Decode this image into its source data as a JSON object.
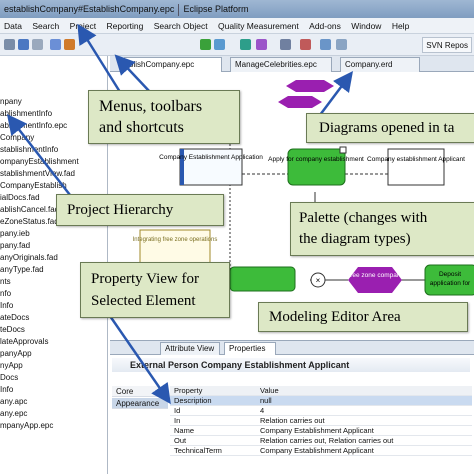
{
  "window": {
    "title_fragment": "establishCompany#EstablishCompany.epc",
    "title_app": "Eclipse Platform"
  },
  "menu": [
    "Data",
    "Search",
    "Project",
    "Reporting",
    "Search Object",
    "Quality Measurement",
    "Add-ons",
    "Window",
    "Help"
  ],
  "toolbar": {
    "svn_label": "SVN Repos"
  },
  "editor_tabs": [
    {
      "label": "blishCompany.epc",
      "active": true
    },
    {
      "label": "ManageCelebrities.epc",
      "active": false
    },
    {
      "label": "Company.erd",
      "active": false
    }
  ],
  "tree": [
    "npany",
    "ablishmentInfo",
    "ablishmentInfo.epc",
    "Company",
    "stablishmentInfo",
    "ompanyEstablishment",
    "stablishmentView.fad",
    "CompanyEstablish",
    "ialDocs.fad",
    "ablishCancel.fad",
    "eZoneStatus.fad",
    "pany.ieb",
    "pany.fad",
    "anyOriginals.fad",
    "anyType.fad",
    "nts",
    "nfo",
    "Info",
    "ateDocs",
    "teDocs",
    "lateApprovals",
    "panyApp",
    "nyApp",
    "Docs",
    "Info",
    "any.apc",
    "any.epc",
    "mpanyApp.epc"
  ],
  "diagram": {
    "node1": "Company Establishment Application",
    "node2": "Apply for company establishment",
    "node3": "Company establishment Applicant",
    "node4": "Integrating free zone operations",
    "node5": "Free zone company",
    "node6a": "Deposit",
    "node6b": "application for"
  },
  "properties": {
    "tabs": [
      "Attribute View",
      "Properties"
    ],
    "title": "External Person Company Establishment Applicant",
    "sidebar": [
      "Core",
      "Appearance"
    ],
    "columns": [
      "Property",
      "Value"
    ],
    "rows": [
      {
        "property": "Description",
        "value": "null"
      },
      {
        "property": "Id",
        "value": "4"
      },
      {
        "property": "In",
        "value": "Relation carries out"
      },
      {
        "property": "Name",
        "value": "Company Establishment Applicant"
      },
      {
        "property": "Out",
        "value": "Relation carries out, Relation carries out"
      },
      {
        "property": "TechnicalTerm",
        "value": "Company Establishment Applicant"
      }
    ]
  },
  "callouts": {
    "menus_line1": "Menus, toolbars",
    "menus_line2": "and shortcuts",
    "diagrams": "Diagrams opened in ta",
    "hierarchy": "Project Hierarchy",
    "palette_line1": "Palette (changes with",
    "palette_line2": "the diagram types)",
    "propview_line1": "Property View for",
    "propview_line2": "Selected Element",
    "modeling": "Modeling Editor Area"
  },
  "colors": {
    "callout_fill": "#dde8c6",
    "event_purple": "#9a1fb0",
    "function_green": "#3dbb3a",
    "cube_yellow": "#ffe066",
    "arrow_blue": "#2a58b0"
  }
}
